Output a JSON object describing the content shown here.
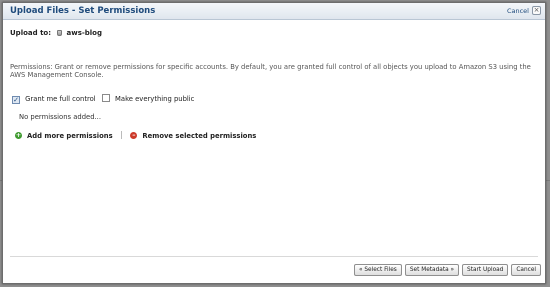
{
  "dialog": {
    "title": "Upload Files - Set Permissions",
    "cancel_link": "Cancel",
    "close_glyph": "×"
  },
  "upload_to": {
    "label": "Upload to:",
    "bucket": "aws-blog"
  },
  "description": "Permissions: Grant or remove permissions for specific accounts. By default, you are granted full control of all objects you upload to Amazon S3 using the AWS Management Console.",
  "checkboxes": [
    {
      "label": "Grant me full control",
      "checked": true
    },
    {
      "label": "Make everything public",
      "checked": false
    }
  ],
  "no_permissions_text": "No permissions added...",
  "actions": {
    "add_label": "Add more permissions",
    "remove_label": "Remove selected permissions",
    "add_glyph": "+",
    "remove_glyph": "–"
  },
  "footer_buttons": {
    "select_files": "« Select Files",
    "set_metadata": "Set Metadata »",
    "start_upload": "Start Upload",
    "cancel": "Cancel"
  },
  "colors": {
    "title": "#1f4b7c",
    "add_icon": "#3f9a2f",
    "remove_icon": "#cc3a2a"
  }
}
